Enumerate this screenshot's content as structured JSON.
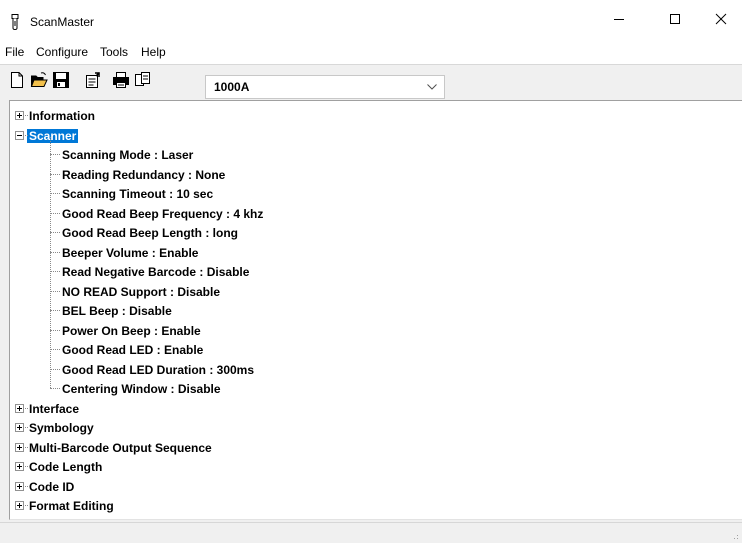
{
  "window": {
    "title": "ScanMaster",
    "title_icon": "barcode-scanner-icon"
  },
  "window_controls": {
    "minimize": "minimize-icon",
    "maximize": "maximize-icon",
    "close": "close-icon"
  },
  "menu": [
    "File",
    "Configure",
    "Tools",
    "Help"
  ],
  "toolbar": {
    "buttons": [
      "new-file-icon",
      "open-folder-icon",
      "save-icon",
      "properties-icon",
      "print-icon",
      "copy-icon"
    ],
    "model": {
      "selected": "1000A"
    }
  },
  "tree": {
    "nodes": [
      {
        "label": "Information",
        "expanded": false
      },
      {
        "label": "Scanner",
        "expanded": true,
        "selected": true,
        "children": [
          "Scanning Mode : Laser",
          "Reading Redundancy : None",
          "Scanning Timeout : 10 sec",
          "Good Read Beep Frequency : 4 khz",
          "Good Read Beep Length : long",
          "Beeper Volume : Enable",
          "Read Negative Barcode : Disable",
          "NO READ Support : Disable",
          "BEL Beep : Disable",
          "Power On Beep : Enable",
          "Good Read LED : Enable",
          "Good Read LED Duration : 300ms",
          "Centering Window : Disable"
        ]
      },
      {
        "label": "Interface",
        "expanded": false
      },
      {
        "label": "Symbology",
        "expanded": false
      },
      {
        "label": "Multi-Barcode Output Sequence",
        "expanded": false
      },
      {
        "label": "Code Length",
        "expanded": false
      },
      {
        "label": "Code ID",
        "expanded": false
      },
      {
        "label": "Format Editing",
        "expanded": false
      }
    ]
  },
  "colors": {
    "selection": "#0078d7",
    "window_bg": "#f0f0f0",
    "panel_bg": "#ffffff"
  }
}
